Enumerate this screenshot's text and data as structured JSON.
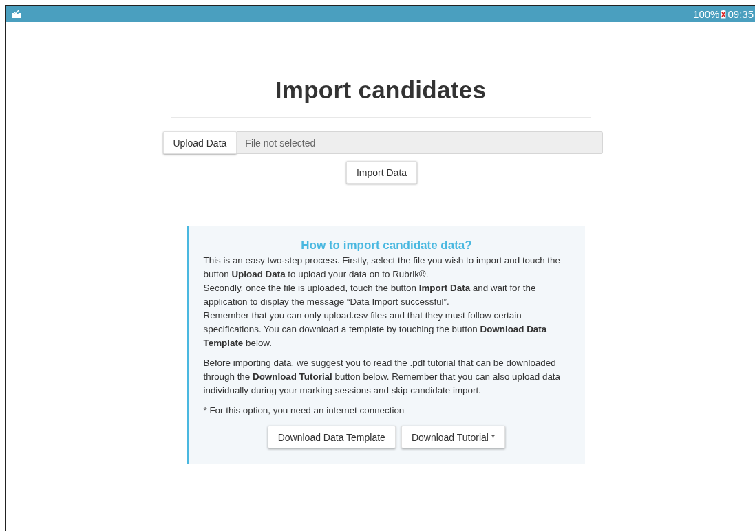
{
  "status_bar": {
    "battery": "100%",
    "time": "09:35"
  },
  "page": {
    "title": "Import candidates"
  },
  "upload": {
    "button": "Upload Data",
    "placeholder": "File not selected"
  },
  "import_button": "Import Data",
  "help": {
    "title": "How to import candidate data?",
    "paragraphs": [
      [
        "This is an easy two-step process. Firstly, select the file you wish to import and touch the button **Upload Data** to upload your data on to Rubrik®.",
        "Secondly, once the file is uploaded, touch the button **Import Data** and wait for the application to display the message “Data Import successful”.",
        "Remember that you can only upload.csv files and that they must follow certain specifications. You can download a template by touching the button **Download Data Template** below."
      ],
      [
        "Before importing data, we suggest you to read the .pdf tutorial that can be downloaded through the **Download Tutorial** button below. Remember that you can also upload data individually during your marking sessions and skip candidate import."
      ],
      [
        "* For this option, you need an internet connection"
      ]
    ],
    "buttons": [
      "Download Data Template",
      "Download Tutorial *"
    ]
  }
}
